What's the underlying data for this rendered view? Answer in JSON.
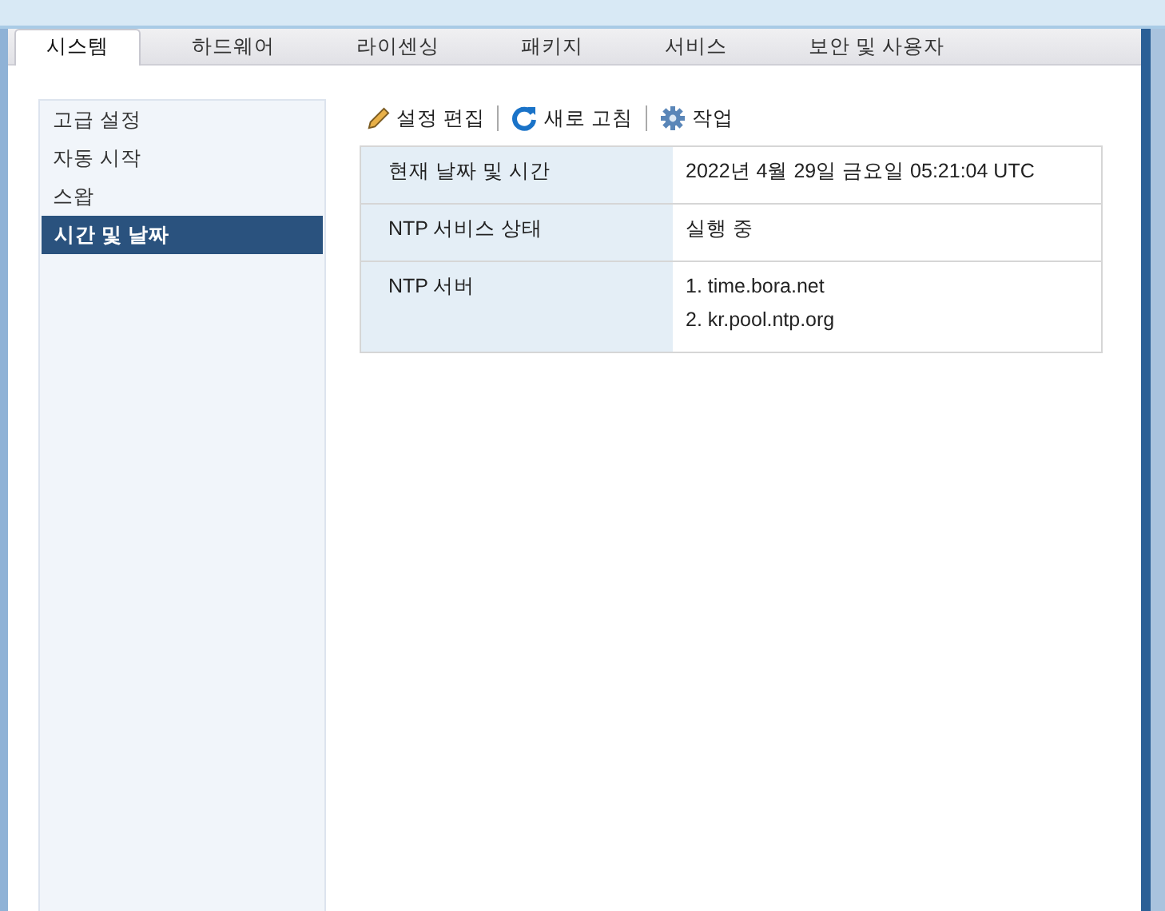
{
  "tabs": [
    {
      "label": "시스템",
      "selected": true
    },
    {
      "label": "하드웨어",
      "selected": false
    },
    {
      "label": "라이센싱",
      "selected": false
    },
    {
      "label": "패키지",
      "selected": false
    },
    {
      "label": "서비스",
      "selected": false
    },
    {
      "label": "보안 및 사용자",
      "selected": false
    }
  ],
  "sidebar": {
    "items": [
      {
        "label": "고급 설정",
        "selected": false
      },
      {
        "label": "자동 시작",
        "selected": false
      },
      {
        "label": "스왑",
        "selected": false
      },
      {
        "label": "시간 및 날짜",
        "selected": true
      }
    ]
  },
  "toolbar": [
    {
      "kind": "edit",
      "label": "설정 편집"
    },
    {
      "kind": "refresh",
      "label": "새로 고침"
    },
    {
      "kind": "actions",
      "label": "작업"
    }
  ],
  "table": {
    "rows": [
      {
        "label": "현재 날짜 및 시간",
        "values": [
          "2022년 4월 29일 금요일 05:21:04 UTC"
        ]
      },
      {
        "label": "NTP 서비스 상태",
        "values": [
          "실행 중"
        ]
      },
      {
        "label": "NTP 서버",
        "values": [
          "1. time.bora.net",
          "2. kr.pool.ntp.org"
        ]
      }
    ]
  }
}
